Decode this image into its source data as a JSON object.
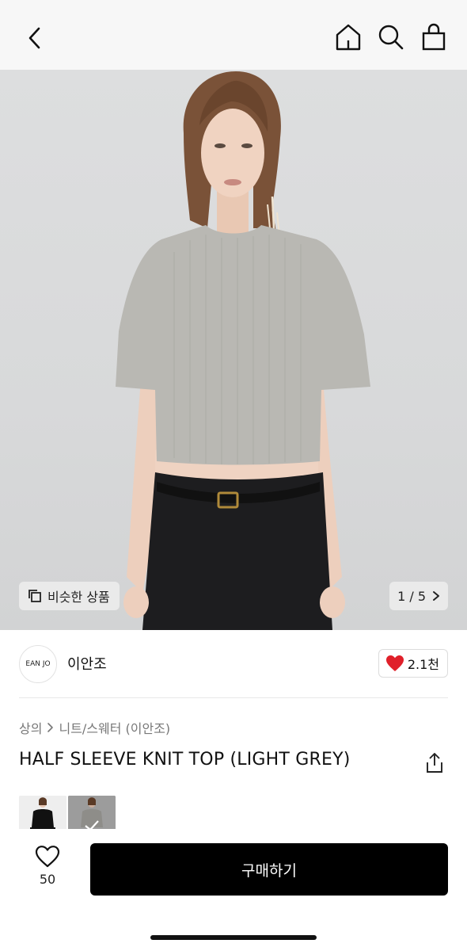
{
  "nav": {
    "back_icon": "chevron-left-icon",
    "home_icon": "home-icon",
    "search_icon": "search-icon",
    "bag_icon": "shopping-bag-icon"
  },
  "hero": {
    "similar_label": "비슷한 상품",
    "similar_icon": "copy-icon",
    "page_indicator": "1 / 5"
  },
  "brand": {
    "logo_text": "EAN JO",
    "name": "이안조",
    "likes": "2.1천",
    "like_color": "#e0202a"
  },
  "breadcrumb": {
    "category": "상의",
    "subcategory": "니트/스웨터 (이안조)"
  },
  "product": {
    "title": "HALF SLEEVE KNIT TOP (LIGHT GREY)"
  },
  "bottom": {
    "wish_count": "50",
    "buy_label": "구매하기"
  },
  "colors": {
    "buy_button": "#000000",
    "nav_bg": "#f7f7f7"
  }
}
